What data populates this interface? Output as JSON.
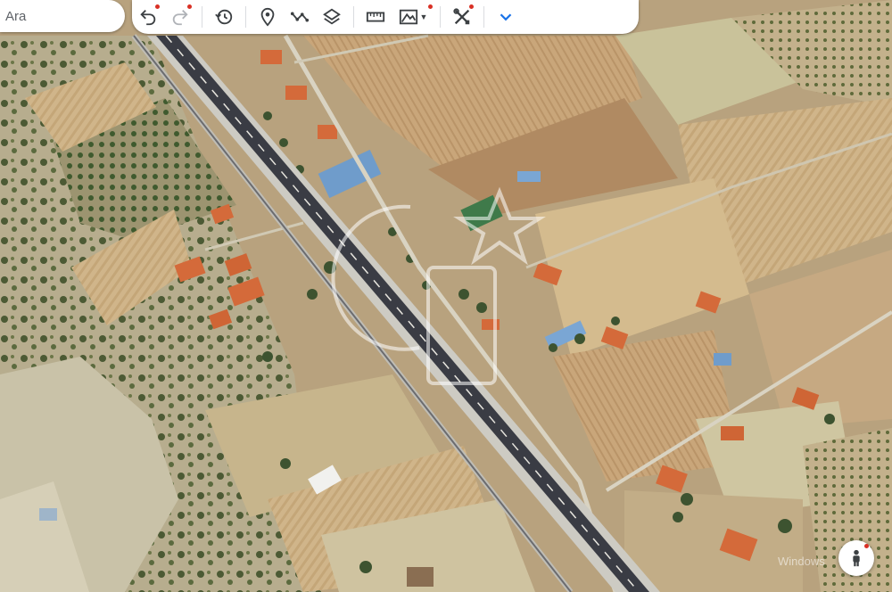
{
  "search": {
    "placeholder": "Ara"
  },
  "toolbar": {
    "buttons": [
      {
        "name": "undo-icon",
        "dot": true
      },
      {
        "name": "redo-icon",
        "dot": true
      },
      {
        "name": "history-icon",
        "dot": false
      },
      {
        "name": "placemark-icon",
        "dot": false
      },
      {
        "name": "path-icon",
        "dot": false
      },
      {
        "name": "layers-icon",
        "dot": false
      },
      {
        "name": "ruler-icon",
        "dot": false
      },
      {
        "name": "elevation-icon",
        "dot": true
      },
      {
        "name": "tools-icon",
        "dot": true
      },
      {
        "name": "chevron-down-icon",
        "dot": false
      }
    ],
    "accent": "#1a73e8",
    "badge_color": "#d93025"
  },
  "map": {
    "view": "satellite",
    "watermark_text": "Windows"
  },
  "pegman": {
    "icon": "street-view-icon",
    "dot": true
  }
}
